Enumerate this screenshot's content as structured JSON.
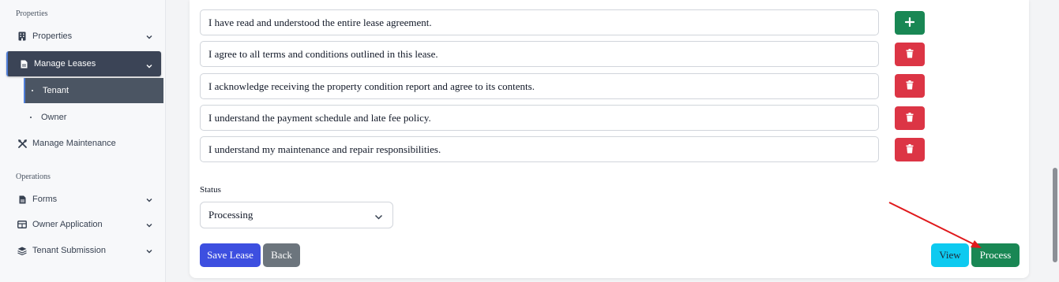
{
  "sidebar": {
    "sections": [
      {
        "label": "Properties"
      },
      {
        "label": "Operations"
      }
    ],
    "items": [
      {
        "label": "Properties",
        "icon": "building-icon"
      },
      {
        "label": "Manage Leases",
        "icon": "document-icon"
      },
      {
        "label": "Manage Maintenance",
        "icon": "tools-icon"
      },
      {
        "label": "Forms",
        "icon": "document-icon"
      },
      {
        "label": "Owner Application",
        "icon": "table-icon"
      },
      {
        "label": "Tenant Submission",
        "icon": "layers-icon"
      }
    ],
    "sub_items": [
      {
        "label": "Tenant"
      },
      {
        "label": "Owner"
      }
    ]
  },
  "acknowledgements": [
    {
      "value": "I have read and understood the entire lease agreement.",
      "action": "add"
    },
    {
      "value": "I agree to all terms and conditions outlined in this lease.",
      "action": "delete"
    },
    {
      "value": "I acknowledge receiving the property condition report and agree to its contents.",
      "action": "delete"
    },
    {
      "value": "I understand the payment schedule and late fee policy.",
      "action": "delete"
    },
    {
      "value": "I understand my maintenance and repair responsibilities.",
      "action": "delete"
    }
  ],
  "status": {
    "label": "Status",
    "selected": "Processing"
  },
  "buttons": {
    "save": "Save Lease",
    "back": "Back",
    "view": "View",
    "process": "Process"
  },
  "colors": {
    "accent_blue": "#3d4fe0",
    "success": "#198754",
    "danger": "#dc3545",
    "info": "#0dcaf0",
    "secondary": "#6c757d",
    "sidebar_active": "#3b4456",
    "annotation_arrow": "#e0191c"
  }
}
